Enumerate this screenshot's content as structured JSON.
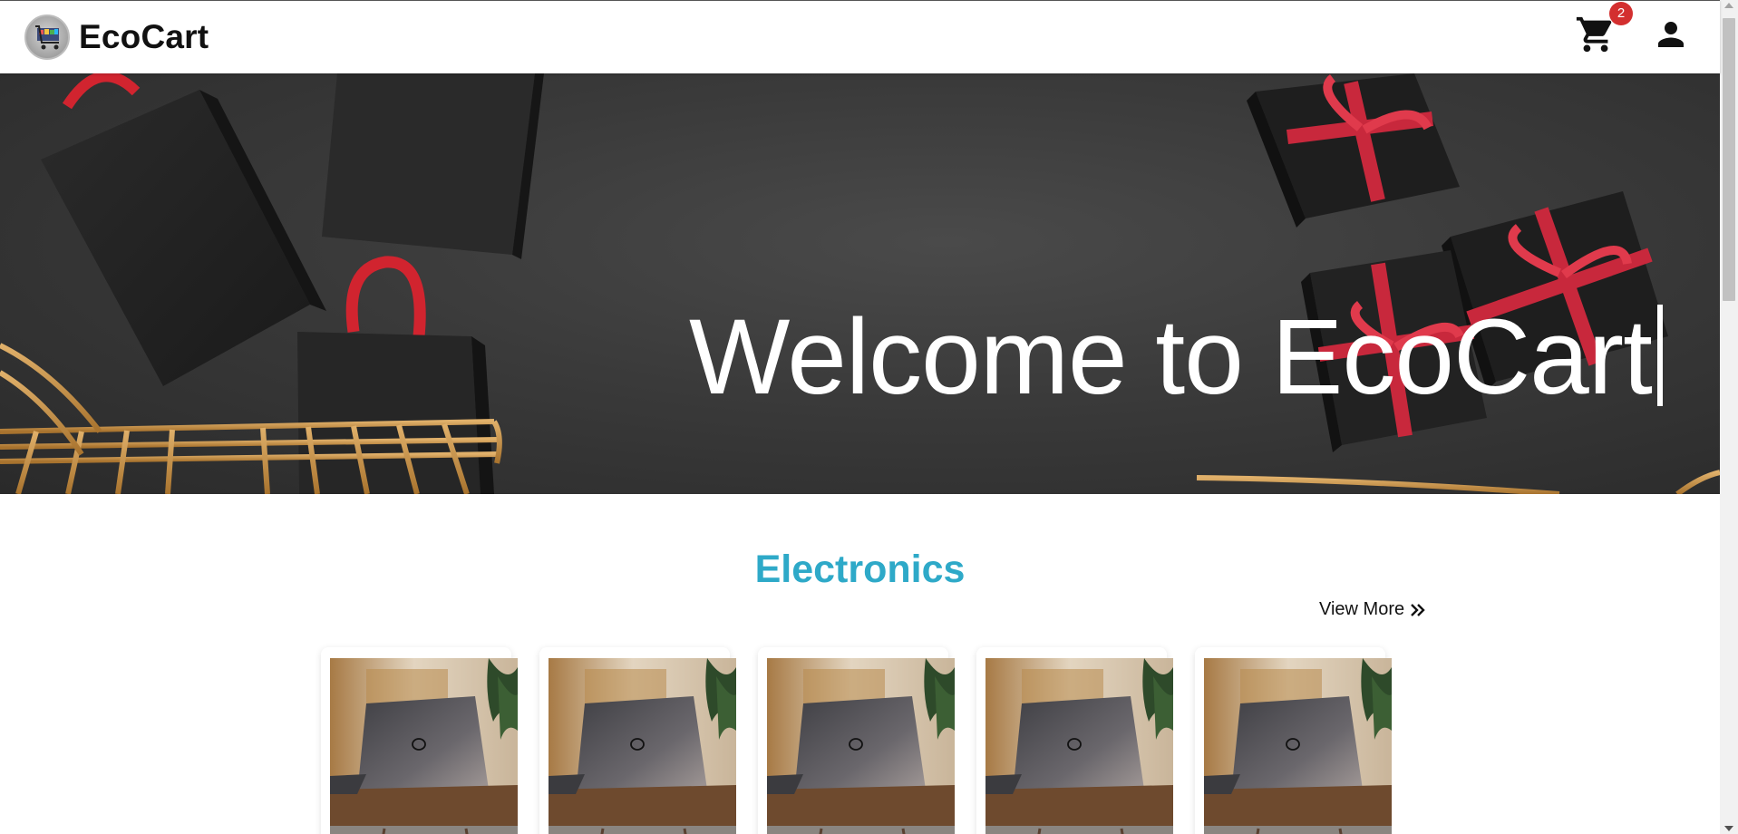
{
  "header": {
    "brand_name": "EcoCart",
    "logo_icon": "shopping-cart-logo-icon",
    "cart_icon": "cart-icon",
    "cart_count": "2",
    "user_icon": "user-icon"
  },
  "hero": {
    "title": "Welcome to EcoCart"
  },
  "section": {
    "title": "Electronics",
    "view_more_label": "View More",
    "view_more_icon": "double-chevron-right-icon",
    "products": [
      {
        "image": "laptop-image"
      },
      {
        "image": "laptop-image"
      },
      {
        "image": "laptop-image"
      },
      {
        "image": "laptop-image"
      },
      {
        "image": "laptop-image"
      }
    ]
  },
  "colors": {
    "accent": "#2ea9c8",
    "badge": "#d32f2f",
    "hero_bg": "#3a3a3a",
    "ribbon": "#c8283c",
    "bag_handle": "#d1242f",
    "cart_gold": "#c8913f"
  }
}
